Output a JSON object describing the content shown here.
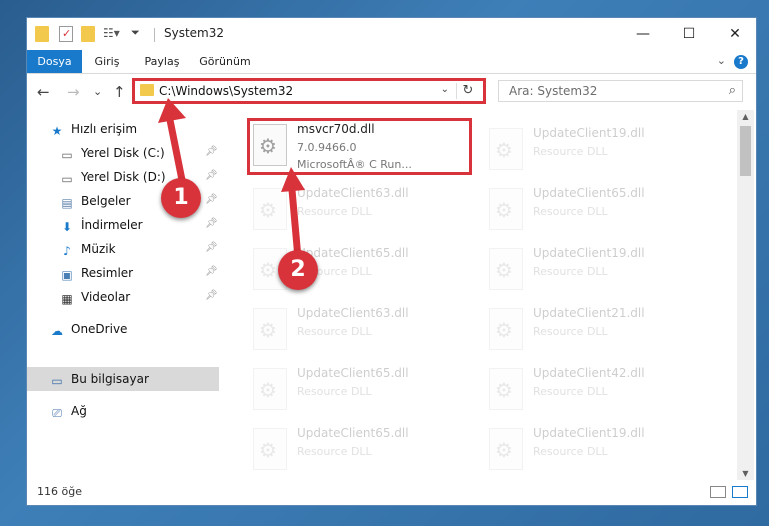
{
  "window": {
    "title": "System32",
    "minimize": "—",
    "maximize": "☐",
    "close": "✕"
  },
  "ribbon": {
    "tabs": [
      "Dosya",
      "Giriş",
      "Paylaş",
      "Görünüm"
    ],
    "help": "?",
    "chevron": "⌄"
  },
  "nav": {
    "back": "←",
    "forward": "→",
    "recent": "⌄",
    "up": "↑",
    "address": "C:\\Windows\\System32",
    "refresh": "↻",
    "search_placeholder": "Ara: System32"
  },
  "sidebar": {
    "quick_access": "Hızlı erişim",
    "items": [
      {
        "label": "Yerel Disk (C:)",
        "icon": "drive-icon"
      },
      {
        "label": "Yerel Disk (D:)",
        "icon": "drive-icon"
      },
      {
        "label": "Belgeler",
        "icon": "documents-icon"
      },
      {
        "label": "İndirmeler",
        "icon": "downloads-icon"
      },
      {
        "label": "Müzik",
        "icon": "music-icon"
      },
      {
        "label": "Resimler",
        "icon": "pictures-icon"
      },
      {
        "label": "Videolar",
        "icon": "videos-icon"
      }
    ],
    "onedrive": "OneDrive",
    "this_pc": "Bu bilgisayar",
    "network": "Ağ"
  },
  "files": {
    "highlighted": {
      "name": "msvcr70d.dll",
      "version": "7.0.9466.0",
      "description": "MicrosoftÂ® C Run..."
    },
    "left_column": [
      {
        "name": "UpdateClient63.dll",
        "type": "Resource DLL"
      },
      {
        "name": "UpdateClient65.dll",
        "type": "Resource DLL"
      },
      {
        "name": "UpdateClient63.dll",
        "type": "Resource DLL"
      },
      {
        "name": "UpdateClient65.dll",
        "type": "Resource DLL"
      },
      {
        "name": "UpdateClient65.dll",
        "type": "Resource DLL"
      }
    ],
    "right_column": [
      {
        "name": "UpdateClient19.dll",
        "type": "Resource DLL"
      },
      {
        "name": "UpdateClient65.dll",
        "type": "Resource DLL"
      },
      {
        "name": "UpdateClient19.dll",
        "type": "Resource DLL"
      },
      {
        "name": "UpdateClient21.dll",
        "type": "Resource DLL"
      },
      {
        "name": "UpdateClient42.dll",
        "type": "Resource DLL"
      },
      {
        "name": "UpdateClient19.dll",
        "type": "Resource DLL"
      }
    ]
  },
  "status": {
    "count": "116 öğe"
  },
  "callouts": [
    "1",
    "2"
  ],
  "colors": {
    "accent": "#1979ca",
    "annotation": "#d8323a"
  }
}
